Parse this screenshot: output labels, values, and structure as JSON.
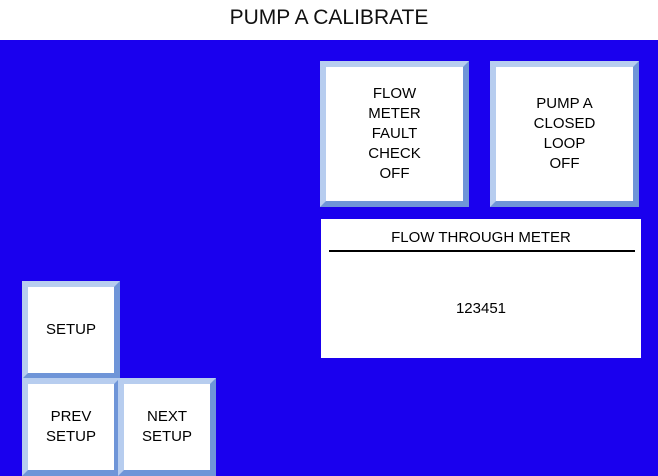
{
  "screen": {
    "title": "PUMP A CALIBRATE",
    "background_color": "#1a00ee"
  },
  "buttons": {
    "flow_meter_fault_check": "FLOW\nMETER\nFAULT\nCHECK\nOFF",
    "pump_a_closed_loop": "PUMP A\nCLOSED\nLOOP\nOFF",
    "setup": "SETUP",
    "prev_setup": "PREV\nSETUP",
    "next_setup": "NEXT\nSETUP"
  },
  "flow_meter_display": {
    "label": "FLOW THROUGH METER",
    "value": "123451"
  }
}
